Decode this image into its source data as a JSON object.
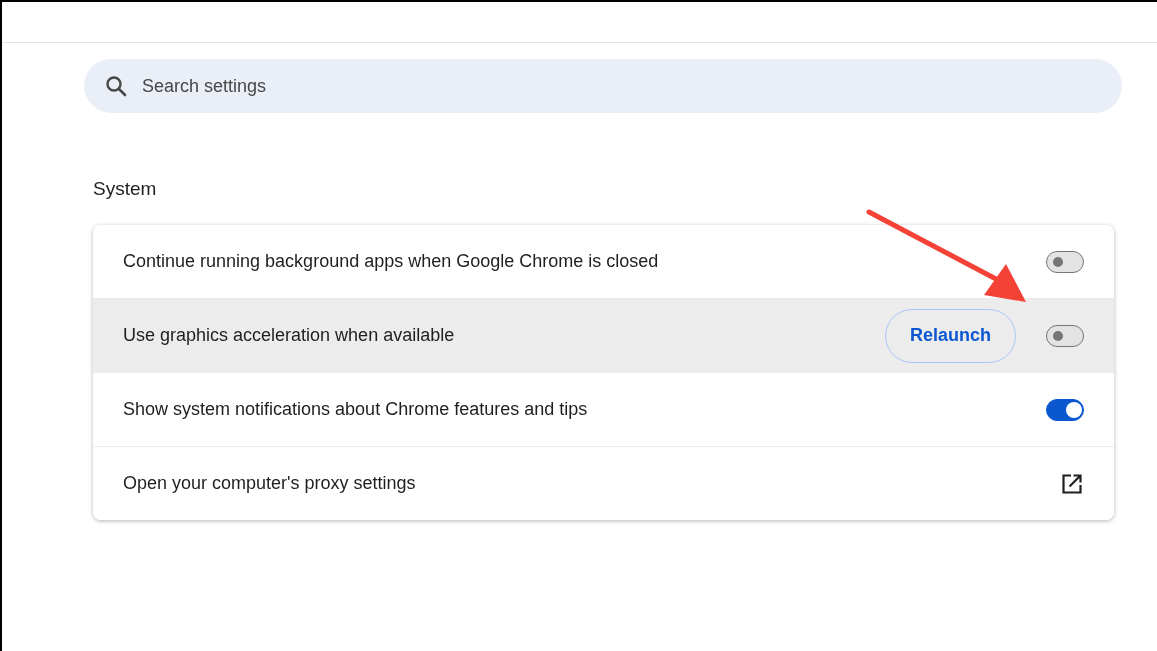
{
  "search": {
    "placeholder": "Search settings"
  },
  "section": {
    "title": "System"
  },
  "rows": [
    {
      "kind": "toggle",
      "label": "Continue running background apps when Google Chrome is closed",
      "highlighted": false,
      "on": false
    },
    {
      "kind": "toggle",
      "label": "Use graphics acceleration when available",
      "highlighted": true,
      "on": false,
      "button": "Relaunch"
    },
    {
      "kind": "toggle",
      "label": "Show system notifications about Chrome features and tips",
      "highlighted": false,
      "on": true
    },
    {
      "kind": "link",
      "label": "Open your computer's proxy settings",
      "highlighted": false
    }
  ]
}
